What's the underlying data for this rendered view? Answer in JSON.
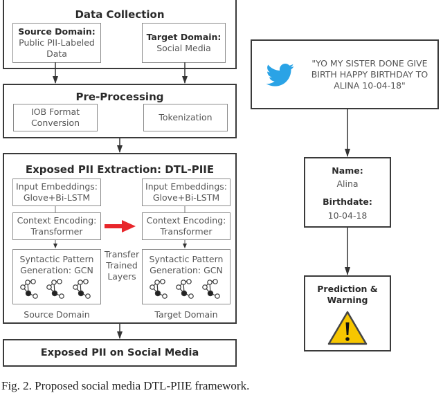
{
  "left_pipeline": {
    "data_collection": {
      "title": "Data Collection",
      "source": {
        "heading": "Source Domain:",
        "line1": "Public PII-Labeled",
        "line2": "Data"
      },
      "target": {
        "heading": "Target Domain:",
        "line1": "Social Media"
      }
    },
    "pre_processing": {
      "title": "Pre-Processing",
      "steps": [
        {
          "line1": "IOB Format",
          "line2": "Conversion"
        },
        {
          "line1": "Tokenization"
        }
      ]
    },
    "extraction": {
      "title": "Exposed PII Extraction: DTL-PIIE",
      "columns": [
        {
          "domain_label": "Source Domain",
          "layers": [
            {
              "line1": "Input Embeddings:",
              "line2": "Glove+Bi-LSTM"
            },
            {
              "line1": "Context Encoding:",
              "line2": "Transformer"
            },
            {
              "line1": "Syntactic Pattern",
              "line2": "Generation: GCN"
            }
          ]
        },
        {
          "domain_label": "Target Domain",
          "layers": [
            {
              "line1": "Input Embeddings:",
              "line2": "Glove+Bi-LSTM"
            },
            {
              "line1": "Context Encoding:",
              "line2": "Transformer"
            },
            {
              "line1": "Syntactic Pattern",
              "line2": "Generation: GCN"
            }
          ]
        }
      ],
      "transfer_label": {
        "line1": "Transfer",
        "line2": "Trained",
        "line3": "Layers"
      },
      "icons": {
        "graph": "graph-network-icon",
        "transfer_arrow": "red-arrow-right-icon"
      }
    },
    "output": {
      "title": "Exposed PII on Social Media"
    }
  },
  "right_pipeline": {
    "tweet": {
      "icon": "twitter-bird-icon",
      "line1": "\"YO MY SISTER DONE GIVE",
      "line2": "BIRTH HAPPY BIRTHDAY TO",
      "line3": "ALINA 10-04-18\""
    },
    "extracted": {
      "name_label": "Name:",
      "name_value": "Alina",
      "birthdate_label": "Birthdate:",
      "birthdate_value": "10-04-18"
    },
    "prediction": {
      "line1": "Prediction &",
      "line2": "Warning",
      "icon": "warning-triangle-icon"
    }
  },
  "colors": {
    "arrow_red": "#e8262b",
    "twitter_blue": "#2aa3e6",
    "warning_yellow": "#f7c600",
    "box_border": "#3a3a3a",
    "inner_border": "#8a8a8a"
  },
  "caption": "Fig. 2.   Proposed social media DTL-PIIE framework."
}
